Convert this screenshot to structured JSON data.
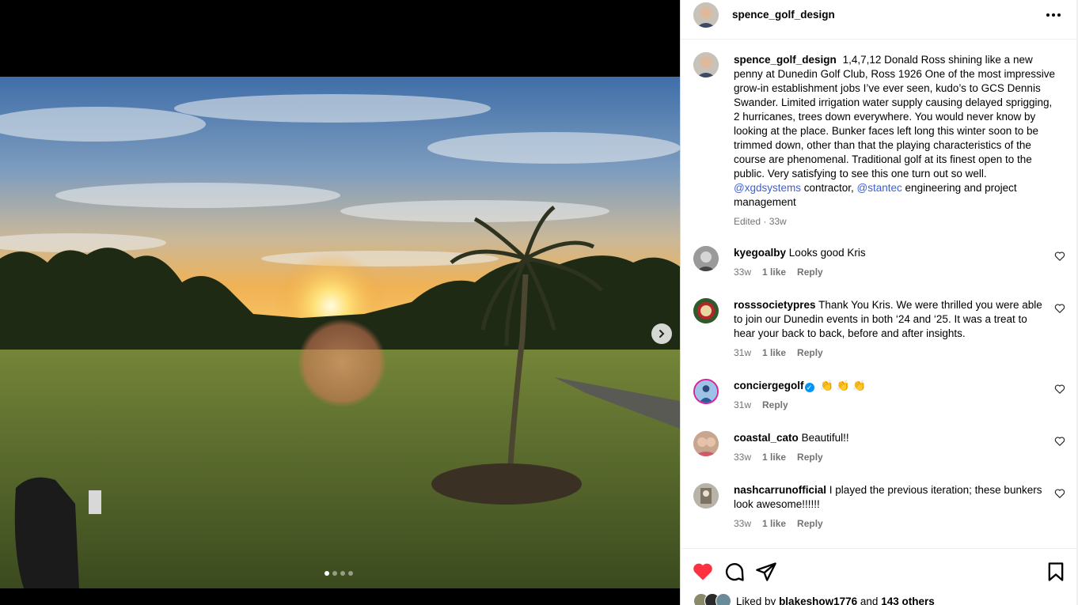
{
  "post": {
    "author": "spence_golf_design",
    "caption_text": "1,4,7,12 Donald Ross shining like a new penny at Dunedin Golf Club, Ross 1926 One of the most impressive grow-in establishment jobs I’ve ever seen, kudo’s to GCS Dennis Swander. Limited irrigation water supply causing delayed sprigging, 2 hurricanes, trees down everywhere. You would never know by looking at the place. Bunker faces left long this winter soon to be trimmed down, other than that the playing characteristics of the course are phenomenal. Traditional golf at its finest open to the public. Very satisfying to see this one turn out so well.",
    "mention_1": "@xgdsystems",
    "after_mention_1": "contractor,",
    "mention_2": "@stantec",
    "after_mention_2": "engineering and project management",
    "meta": "Edited · 33w"
  },
  "carousel": {
    "total": 4,
    "active": 1
  },
  "comments": [
    {
      "user": "kyegoalby",
      "text": "Looks good Kris",
      "time": "33w",
      "likes": "1 like",
      "reply": "Reply"
    },
    {
      "user": "rosssocietypres",
      "text": "Thank You Kris. We were thrilled you were able to join our Dunedin events in both ‘24 and ‘25. It was a treat to hear your back to back, before and after insights.",
      "time": "31w",
      "likes": "1 like",
      "reply": "Reply"
    },
    {
      "user": "conciergegolf",
      "text": "👏 👏 👏",
      "time": "31w",
      "likes": "",
      "reply": "Reply",
      "verified": true
    },
    {
      "user": "coastal_cato",
      "text": "Beautiful!!",
      "time": "33w",
      "likes": "1 like",
      "reply": "Reply"
    },
    {
      "user": "nashcarrunofficial",
      "text": "I played the previous iteration; these bunkers look awesome!!!!!!",
      "time": "33w",
      "likes": "1 like",
      "reply": "Reply"
    }
  ],
  "likes": {
    "prefix": "Liked by",
    "user": "blakeshow1776",
    "and": "and",
    "others": "143 others"
  },
  "colors": {
    "heart": "#ff3040",
    "mention": "#3d5fd6",
    "muted": "#737373",
    "verified": "#0095f6"
  },
  "icons": [
    "more-icon",
    "chevron-right-icon",
    "heart-icon",
    "comment-icon",
    "share-icon",
    "bookmark-icon"
  ]
}
